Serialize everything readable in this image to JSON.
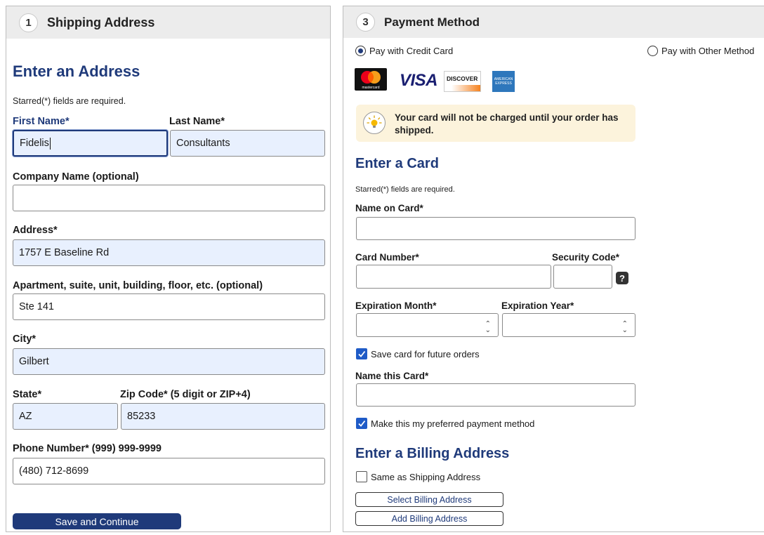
{
  "shipping": {
    "step_number": "1",
    "step_title": "Shipping Address",
    "heading": "Enter an Address",
    "required_note": "Starred(*) fields are required.",
    "first_name_label": "First Name*",
    "first_name_value": "Fidelis",
    "last_name_label": "Last Name*",
    "last_name_value": "Consultants",
    "company_label": "Company Name (optional)",
    "company_value": "",
    "address_label": "Address*",
    "address_value": "1757 E Baseline Rd",
    "apt_label": "Apartment, suite, unit, building, floor, etc. (optional)",
    "apt_value": "Ste 141",
    "city_label": "City*",
    "city_value": "Gilbert",
    "state_label": "State*",
    "state_value": "AZ",
    "zip_label": "Zip Code* (5 digit or ZIP+4)",
    "zip_value": "85233",
    "phone_label": "Phone Number* (999) 999-9999",
    "phone_value": "(480) 712-8699",
    "save_button": "Save and Continue"
  },
  "payment": {
    "step_number": "3",
    "step_title": "Payment Method",
    "credit_card_option": "Pay with Credit Card",
    "other_method_option": "Pay with Other Method",
    "selected_option": "credit_card",
    "card_brands": [
      "mastercard",
      "VISA",
      "DISCOVER",
      "AMERICAN EXPRESS"
    ],
    "notice_text": "Your card will not be charged until your order has shipped.",
    "card_heading": "Enter a Card",
    "required_note": "Starred(*) fields are required.",
    "name_on_card_label": "Name on Card*",
    "card_number_label": "Card Number*",
    "security_code_label": "Security Code*",
    "help_glyph": "?",
    "exp_month_label": "Expiration Month*",
    "exp_year_label": "Expiration Year*",
    "save_card_label": "Save card for future orders",
    "save_card_checked": true,
    "name_card_label": "Name this Card*",
    "preferred_label": "Make this my preferred payment method",
    "preferred_checked": true,
    "billing_heading": "Enter a Billing Address",
    "same_as_shipping_label": "Same as Shipping Address",
    "same_as_shipping_checked": false,
    "select_billing_button": "Select Billing Address",
    "add_billing_button": "Add Billing Address"
  },
  "colors": {
    "brand_blue": "#1f3a7a",
    "autofill_bg": "#e8f0fe",
    "notice_bg": "#fcf3dc",
    "header_bg": "#ececec",
    "checkbox_blue": "#1f5bc7"
  },
  "icons": {
    "notice": "lightbulb-icon",
    "help": "question-help-icon",
    "select_arrow": "up-down-chevron-icon",
    "check": "checkmark-icon"
  }
}
